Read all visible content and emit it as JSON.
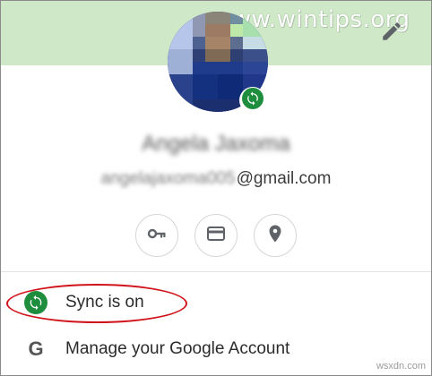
{
  "watermark": {
    "text": "www.wintips.org"
  },
  "profile": {
    "name_blurred": "Angela Jaxoma",
    "email_user_blurred": "angelajaxoma005",
    "email_domain": "@gmail.com"
  },
  "icons": {
    "edit": "pencil-icon",
    "avatar_badge": "sync-icon",
    "passwords": "key-icon",
    "payments": "credit-card-icon",
    "addresses": "location-pin-icon",
    "sync": "sync-icon",
    "google": "google-icon"
  },
  "menu": {
    "sync_label": "Sync is on",
    "google_letter": "G",
    "google_label": "Manage your Google Account"
  },
  "colors": {
    "banner": "#cfe9c8",
    "sync_green": "#1e8e3e",
    "highlight_red": "#d0141b"
  },
  "footer": {
    "credit": "wsxdn.com"
  }
}
